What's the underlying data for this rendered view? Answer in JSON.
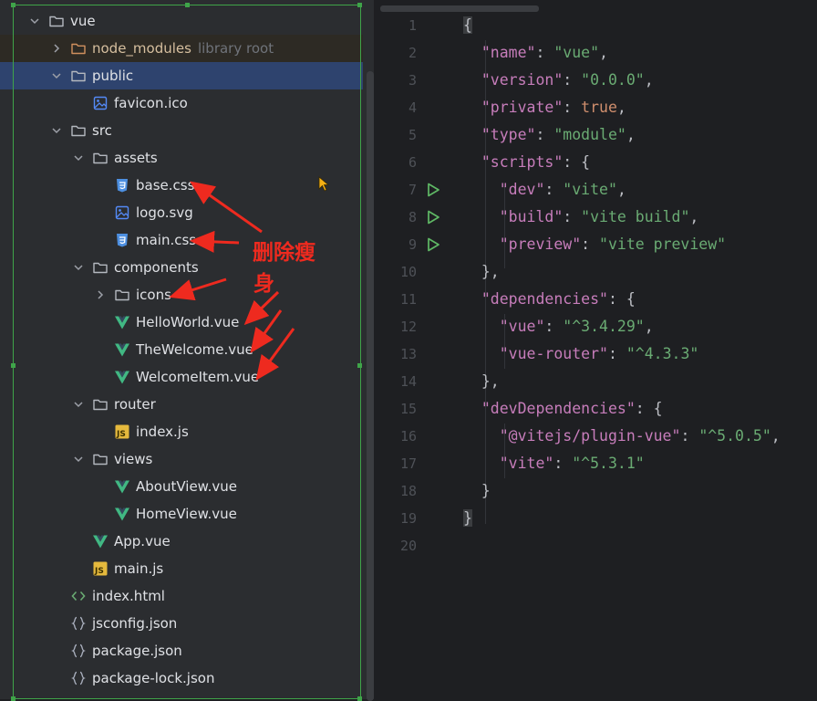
{
  "tree": [
    {
      "label": "vue",
      "icon": "folder",
      "depth": 0,
      "chevron": "down"
    },
    {
      "label": "node_modules",
      "hint": "library root",
      "icon": "folder-orange",
      "depth": 1,
      "chevron": "right",
      "style": "lib"
    },
    {
      "label": "public",
      "icon": "folder",
      "depth": 1,
      "chevron": "down",
      "style": "sel"
    },
    {
      "label": "favicon.ico",
      "icon": "image",
      "depth": 2,
      "chevron": "none"
    },
    {
      "label": "src",
      "icon": "folder",
      "depth": 1,
      "chevron": "down"
    },
    {
      "label": "assets",
      "icon": "folder",
      "depth": 2,
      "chevron": "down"
    },
    {
      "label": "base.css",
      "icon": "css",
      "depth": 3,
      "chevron": "none"
    },
    {
      "label": "logo.svg",
      "icon": "image",
      "depth": 3,
      "chevron": "none"
    },
    {
      "label": "main.css",
      "icon": "css",
      "depth": 3,
      "chevron": "none"
    },
    {
      "label": "components",
      "icon": "folder",
      "depth": 2,
      "chevron": "down"
    },
    {
      "label": "icons",
      "icon": "folder",
      "depth": 3,
      "chevron": "right"
    },
    {
      "label": "HelloWorld.vue",
      "icon": "vue",
      "depth": 3,
      "chevron": "none"
    },
    {
      "label": "TheWelcome.vue",
      "icon": "vue",
      "depth": 3,
      "chevron": "none"
    },
    {
      "label": "WelcomeItem.vue",
      "icon": "vue",
      "depth": 3,
      "chevron": "none"
    },
    {
      "label": "router",
      "icon": "folder",
      "depth": 2,
      "chevron": "down"
    },
    {
      "label": "index.js",
      "icon": "js",
      "depth": 3,
      "chevron": "none"
    },
    {
      "label": "views",
      "icon": "folder",
      "depth": 2,
      "chevron": "down"
    },
    {
      "label": "AboutView.vue",
      "icon": "vue",
      "depth": 3,
      "chevron": "none"
    },
    {
      "label": "HomeView.vue",
      "icon": "vue",
      "depth": 3,
      "chevron": "none"
    },
    {
      "label": "App.vue",
      "icon": "vue",
      "depth": 2,
      "chevron": "none"
    },
    {
      "label": "main.js",
      "icon": "js",
      "depth": 2,
      "chevron": "none"
    },
    {
      "label": "index.html",
      "icon": "html",
      "depth": 1,
      "chevron": "none"
    },
    {
      "label": "jsconfig.json",
      "icon": "json",
      "depth": 1,
      "chevron": "none"
    },
    {
      "label": "package.json",
      "icon": "json",
      "depth": 1,
      "chevron": "none"
    },
    {
      "label": "package-lock.json",
      "icon": "json",
      "depth": 1,
      "chevron": "none"
    }
  ],
  "editor": {
    "lines": [
      {
        "n": "1",
        "run": false,
        "tokens": [
          [
            "{",
            "brk"
          ]
        ]
      },
      {
        "n": "2",
        "run": false,
        "tokens": [
          [
            "  ",
            ""
          ],
          [
            "\"name\"",
            "k"
          ],
          [
            ": ",
            ""
          ],
          [
            "\"vue\"",
            "s"
          ],
          [
            ",",
            ""
          ]
        ]
      },
      {
        "n": "3",
        "run": false,
        "tokens": [
          [
            "  ",
            ""
          ],
          [
            "\"version\"",
            "k"
          ],
          [
            ": ",
            ""
          ],
          [
            "\"0.0.0\"",
            "s"
          ],
          [
            ",",
            ""
          ]
        ]
      },
      {
        "n": "4",
        "run": false,
        "tokens": [
          [
            "  ",
            ""
          ],
          [
            "\"private\"",
            "k"
          ],
          [
            ": ",
            ""
          ],
          [
            "true",
            "b"
          ],
          [
            ",",
            ""
          ]
        ]
      },
      {
        "n": "5",
        "run": false,
        "tokens": [
          [
            "  ",
            ""
          ],
          [
            "\"type\"",
            "k"
          ],
          [
            ": ",
            ""
          ],
          [
            "\"module\"",
            "s"
          ],
          [
            ",",
            ""
          ]
        ]
      },
      {
        "n": "6",
        "run": false,
        "tokens": [
          [
            "  ",
            ""
          ],
          [
            "\"scripts\"",
            "k"
          ],
          [
            ": {",
            ""
          ]
        ]
      },
      {
        "n": "7",
        "run": true,
        "tokens": [
          [
            "    ",
            ""
          ],
          [
            "\"dev\"",
            "k"
          ],
          [
            ": ",
            ""
          ],
          [
            "\"vite\"",
            "s"
          ],
          [
            ",",
            ""
          ]
        ]
      },
      {
        "n": "8",
        "run": true,
        "tokens": [
          [
            "    ",
            ""
          ],
          [
            "\"build\"",
            "k"
          ],
          [
            ": ",
            ""
          ],
          [
            "\"vite build\"",
            "s"
          ],
          [
            ",",
            ""
          ]
        ]
      },
      {
        "n": "9",
        "run": true,
        "tokens": [
          [
            "    ",
            ""
          ],
          [
            "\"preview\"",
            "k"
          ],
          [
            ": ",
            ""
          ],
          [
            "\"vite preview\"",
            "s"
          ]
        ]
      },
      {
        "n": "10",
        "run": false,
        "tokens": [
          [
            "  },",
            ""
          ]
        ]
      },
      {
        "n": "11",
        "run": false,
        "tokens": [
          [
            "  ",
            ""
          ],
          [
            "\"dependencies\"",
            "k"
          ],
          [
            ": {",
            ""
          ]
        ]
      },
      {
        "n": "12",
        "run": false,
        "tokens": [
          [
            "    ",
            ""
          ],
          [
            "\"vue\"",
            "k"
          ],
          [
            ": ",
            ""
          ],
          [
            "\"^3.4.29\"",
            "s"
          ],
          [
            ",",
            ""
          ]
        ]
      },
      {
        "n": "13",
        "run": false,
        "tokens": [
          [
            "    ",
            ""
          ],
          [
            "\"vue-router\"",
            "k"
          ],
          [
            ": ",
            ""
          ],
          [
            "\"^4.3.3\"",
            "s"
          ]
        ]
      },
      {
        "n": "14",
        "run": false,
        "tokens": [
          [
            "  },",
            ""
          ]
        ]
      },
      {
        "n": "15",
        "run": false,
        "tokens": [
          [
            "  ",
            ""
          ],
          [
            "\"devDependencies\"",
            "k"
          ],
          [
            ": {",
            ""
          ]
        ]
      },
      {
        "n": "16",
        "run": false,
        "tokens": [
          [
            "    ",
            ""
          ],
          [
            "\"@vitejs/plugin-vue\"",
            "k"
          ],
          [
            ": ",
            ""
          ],
          [
            "\"^5.0.5\"",
            "s"
          ],
          [
            ",",
            ""
          ]
        ]
      },
      {
        "n": "17",
        "run": false,
        "tokens": [
          [
            "    ",
            ""
          ],
          [
            "\"vite\"",
            "k"
          ],
          [
            ": ",
            ""
          ],
          [
            "\"^5.3.1\"",
            "s"
          ]
        ]
      },
      {
        "n": "18",
        "run": false,
        "tokens": [
          [
            "  }",
            ""
          ]
        ]
      },
      {
        "n": "19",
        "run": false,
        "tokens": [
          [
            "}",
            "brk"
          ]
        ]
      },
      {
        "n": "20",
        "run": false,
        "tokens": []
      }
    ]
  },
  "annotation": {
    "line1": "删除瘦",
    "line2": "身",
    "color": "#ee2a1f"
  },
  "colors": {
    "accent": "#2e436e",
    "run": "#5fb865",
    "folder": "#b4b8bf",
    "css": "#4d8fe0",
    "vue": "#41b883",
    "js": "#e5b93d"
  }
}
